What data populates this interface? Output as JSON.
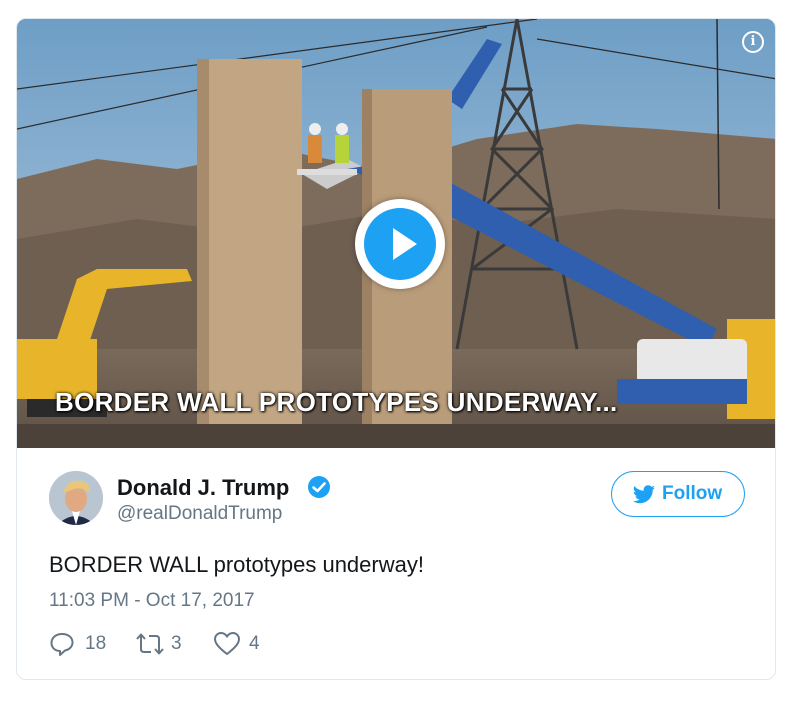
{
  "media": {
    "caption": "BORDER WALL PROTOTYPES UNDERWAY...",
    "play_icon": "play-icon",
    "info_icon": "info-icon",
    "info_glyph": "i"
  },
  "tweet": {
    "display_name": "Donald J. Trump",
    "handle": "@realDonaldTrump",
    "verified": true,
    "follow_label": "Follow",
    "text": "BORDER WALL prototypes underway!",
    "timestamp": "11:03 PM - Oct 17, 2017",
    "replies": "18",
    "retweets": "3",
    "likes": "4"
  },
  "colors": {
    "accent": "#1da1f2",
    "text": "#14171a",
    "muted": "#657786",
    "border": "#e1e8ed"
  }
}
